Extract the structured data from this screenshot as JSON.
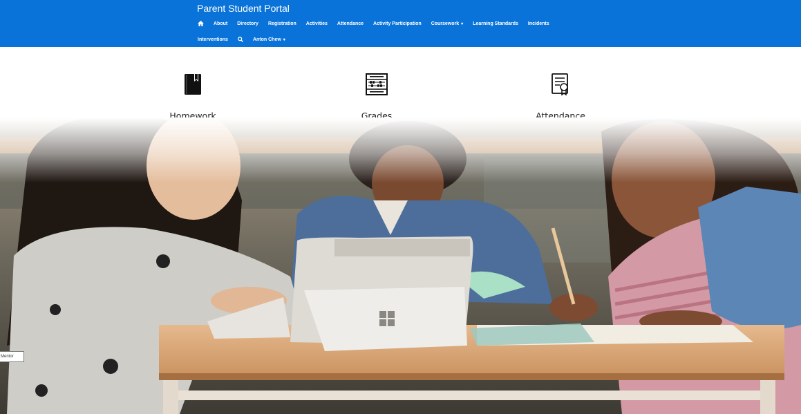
{
  "header": {
    "brand": "Parent Student Portal",
    "color": "#0a73d9",
    "nav_row1": [
      {
        "label": "About"
      },
      {
        "label": "Directory"
      },
      {
        "label": "Registration"
      },
      {
        "label": "Activities"
      },
      {
        "label": "Attendance"
      },
      {
        "label": "Activity Participation"
      },
      {
        "label": "Coursework",
        "dropdown": true
      },
      {
        "label": "Learning Standards"
      },
      {
        "label": "Incidents"
      }
    ],
    "nav_row2": [
      {
        "label": "Interventions"
      },
      {
        "label": "Anton Chew",
        "dropdown": true
      }
    ],
    "home_icon": "home-icon",
    "search_icon": "search-icon"
  },
  "features": [
    {
      "label": "Homework",
      "icon": "book-icon"
    },
    {
      "label": "Grades",
      "icon": "abacus-icon"
    },
    {
      "label": "Attendance",
      "icon": "certificate-icon"
    }
  ],
  "hero": {
    "description_icon": "classroom-photo"
  },
  "side_tab": {
    "label": "ft Mentor"
  }
}
